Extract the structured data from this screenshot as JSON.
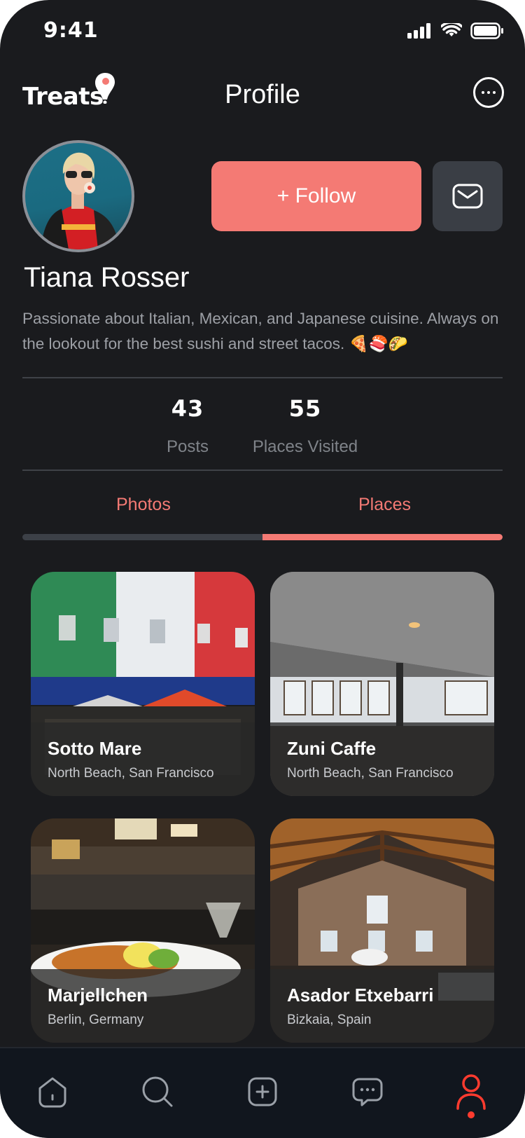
{
  "status_bar": {
    "time": "9:41"
  },
  "header": {
    "logo": "Treats",
    "title": "Profile"
  },
  "profile": {
    "name": "Tiana Rosser",
    "bio": "Passionate about Italian, Mexican, and Japanese cuisine. Always on the lookout for the best sushi and street tacos. 🍕🍣🌮",
    "follow_label": "+ Follow",
    "stats": [
      {
        "value": "43",
        "label": "Posts"
      },
      {
        "value": "55",
        "label": "Places Visited"
      }
    ]
  },
  "tabs": [
    {
      "label": "Photos"
    },
    {
      "label": "Places",
      "active": true
    }
  ],
  "places": [
    {
      "name": "Sotto Mare",
      "location": "North Beach, San Francisco"
    },
    {
      "name": "Zuni Caffe",
      "location": "North Beach, San Francisco"
    },
    {
      "name": "Marjellchen",
      "location": "Berlin, Germany"
    },
    {
      "name": "Asador Etxebarri",
      "location": "Bizkaia, Spain"
    }
  ],
  "nav": {
    "items": [
      "home-icon",
      "search-icon",
      "add-icon",
      "chat-icon",
      "profile-icon"
    ],
    "active": "profile-icon"
  },
  "colors": {
    "accent": "#f47a74",
    "background": "#1a1b1e",
    "nav_background": "#11161e",
    "active_dot": "#ff3b2f"
  }
}
